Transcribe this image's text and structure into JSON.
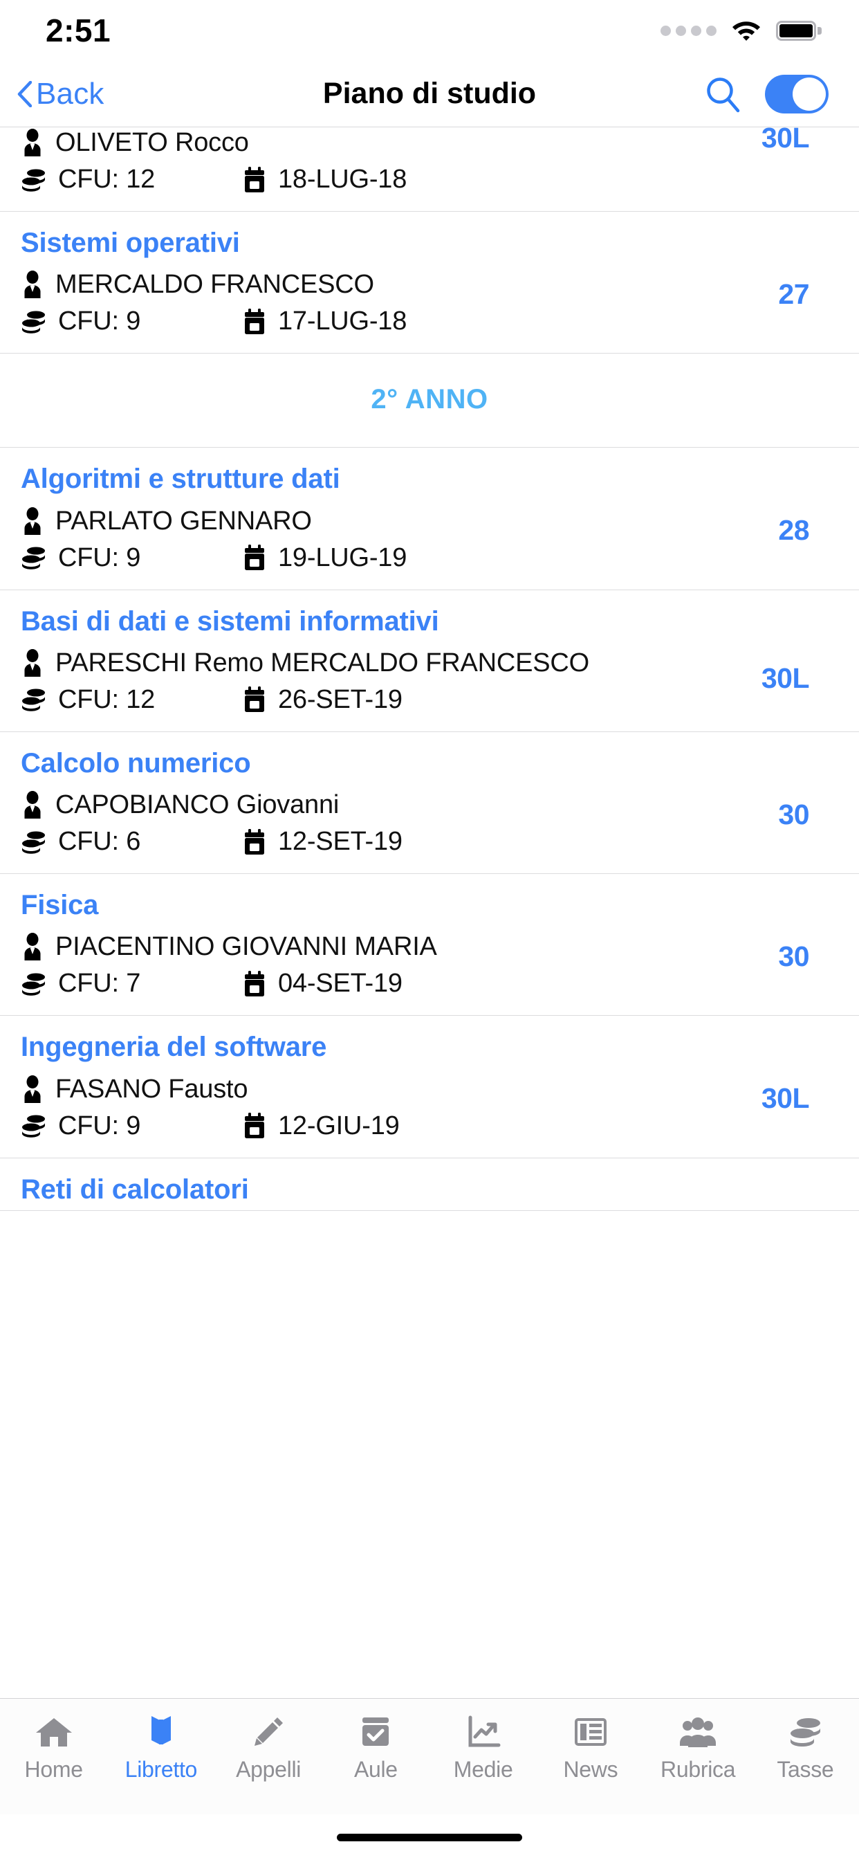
{
  "status_bar": {
    "time": "2:51",
    "signal_icon": "signal-dots-icon",
    "wifi_icon": "wifi-icon",
    "battery_icon": "battery-full-icon"
  },
  "nav_bar": {
    "back_label": "Back",
    "back_icon": "chevron-left-icon",
    "title": "Piano di studio",
    "search_icon": "search-icon",
    "toggle_icon": "toggle-switch-on",
    "toggle_state": "on"
  },
  "colors": {
    "accent_blue": "#3b82f6",
    "year_blue": "#4fb3f5",
    "tab_inactive": "#8e8e93",
    "separator": "#dcdcde"
  },
  "labels": {
    "cfu_prefix": "CFU:",
    "person_icon": "person-icon",
    "coins_icon": "coins-icon",
    "calendar_icon": "calendar-icon"
  },
  "list": {
    "rows": [
      {
        "kind": "exam",
        "clipped": true,
        "title": "",
        "professor": "OLIVETO Rocco",
        "cfu": "CFU: 12",
        "date": "18-LUG-18",
        "grade": "30L"
      },
      {
        "kind": "exam",
        "clipped": false,
        "title": "Sistemi operativi",
        "professor": "MERCALDO FRANCESCO",
        "cfu": "CFU: 9",
        "date": "17-LUG-18",
        "grade": "27"
      },
      {
        "kind": "year",
        "title": "2° ANNO"
      },
      {
        "kind": "exam",
        "clipped": false,
        "title": "Algoritmi e strutture dati",
        "professor": "PARLATO GENNARO",
        "cfu": "CFU: 9",
        "date": "19-LUG-19",
        "grade": "28"
      },
      {
        "kind": "exam",
        "clipped": false,
        "title": "Basi di dati e sistemi informativi",
        "professor": "PARESCHI Remo  MERCALDO FRANCESCO",
        "cfu": "CFU: 12",
        "date": "26-SET-19",
        "grade": "30L"
      },
      {
        "kind": "exam",
        "clipped": false,
        "title": "Calcolo numerico",
        "professor": "CAPOBIANCO Giovanni",
        "cfu": "CFU: 6",
        "date": "12-SET-19",
        "grade": "30"
      },
      {
        "kind": "exam",
        "clipped": false,
        "title": "Fisica",
        "professor": "PIACENTINO GIOVANNI MARIA",
        "cfu": "CFU: 7",
        "date": "04-SET-19",
        "grade": "30"
      },
      {
        "kind": "exam",
        "clipped": false,
        "title": "Ingegneria del software",
        "professor": "FASANO Fausto",
        "cfu": "CFU: 9",
        "date": "12-GIU-19",
        "grade": "30L"
      },
      {
        "kind": "exam_tail",
        "title": "Reti di calcolatori"
      }
    ]
  },
  "tab_bar": {
    "tabs": [
      {
        "label": "Home",
        "icon": "home-icon",
        "active": false
      },
      {
        "label": "Libretto",
        "icon": "book-icon",
        "active": true
      },
      {
        "label": "Appelli",
        "icon": "pencil-icon",
        "active": false
      },
      {
        "label": "Aule",
        "icon": "calendar-check-icon",
        "active": false
      },
      {
        "label": "Medie",
        "icon": "chart-line-icon",
        "active": false
      },
      {
        "label": "News",
        "icon": "newspaper-icon",
        "active": false
      },
      {
        "label": "Rubrica",
        "icon": "people-icon",
        "active": false
      },
      {
        "label": "Tasse",
        "icon": "coins-icon",
        "active": false
      }
    ]
  }
}
